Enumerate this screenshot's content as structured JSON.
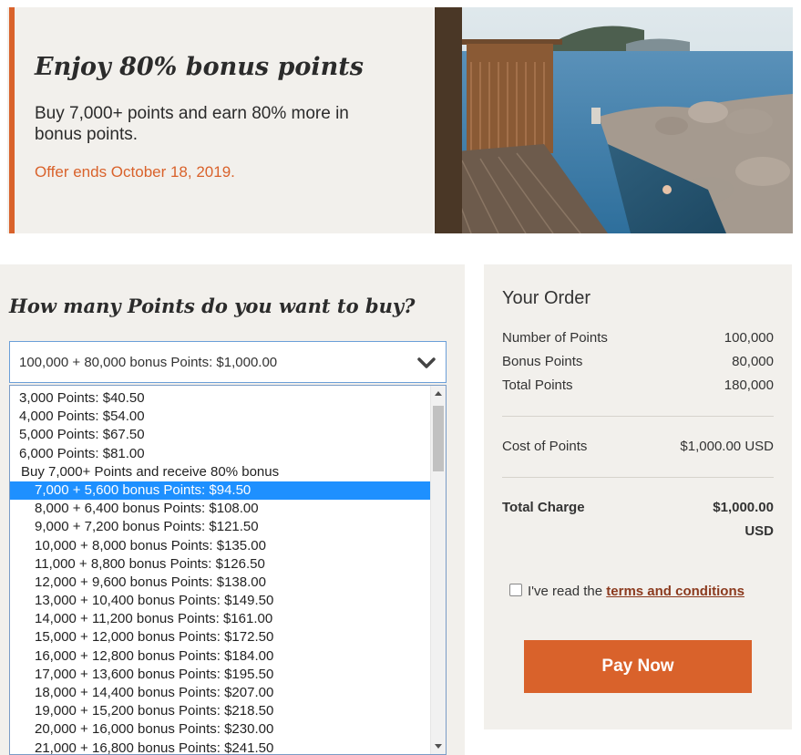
{
  "banner": {
    "title": "Enjoy 80% bonus points",
    "subtitle": "Buy 7,000+ points and earn 80% more in bonus points.",
    "offer_ends": "Offer ends October 18, 2019.",
    "accent_color": "#d9622b",
    "image": "resort-infinity-pool-ocean-photo"
  },
  "purchase": {
    "question": "How many Points do you want to buy?",
    "selected_value": "100,000 + 80,000 bonus Points: $1,000.00",
    "options": [
      {
        "label": "3,000 Points: $40.50",
        "type": "option"
      },
      {
        "label": "4,000 Points: $54.00",
        "type": "option"
      },
      {
        "label": "5,000 Points: $67.50",
        "type": "option"
      },
      {
        "label": "6,000 Points: $81.00",
        "type": "option"
      },
      {
        "label": "Buy 7,000+ Points and receive 80% bonus",
        "type": "group"
      },
      {
        "label": "7,000 + 5,600 bonus Points: $94.50",
        "type": "option",
        "highlighted": true
      },
      {
        "label": "8,000 + 6,400 bonus Points: $108.00",
        "type": "option"
      },
      {
        "label": "9,000 + 7,200 bonus Points: $121.50",
        "type": "option"
      },
      {
        "label": "10,000 + 8,000 bonus Points: $135.00",
        "type": "option"
      },
      {
        "label": "11,000 + 8,800 bonus Points: $126.50",
        "type": "option"
      },
      {
        "label": "12,000 + 9,600 bonus Points: $138.00",
        "type": "option"
      },
      {
        "label": "13,000 + 10,400 bonus Points: $149.50",
        "type": "option"
      },
      {
        "label": "14,000 + 11,200 bonus Points: $161.00",
        "type": "option"
      },
      {
        "label": "15,000 + 12,000 bonus Points: $172.50",
        "type": "option"
      },
      {
        "label": "16,000 + 12,800 bonus Points: $184.00",
        "type": "option"
      },
      {
        "label": "17,000 + 13,600 bonus Points: $195.50",
        "type": "option"
      },
      {
        "label": "18,000 + 14,400 bonus Points: $207.00",
        "type": "option"
      },
      {
        "label": "19,000 + 15,200 bonus Points: $218.50",
        "type": "option"
      },
      {
        "label": "20,000 + 16,000 bonus Points: $230.00",
        "type": "option"
      },
      {
        "label": "21,000 + 16,800 bonus Points: $241.50",
        "type": "option"
      }
    ],
    "highlight_color": "#1e90ff"
  },
  "order": {
    "title": "Your Order",
    "number_of_points_label": "Number of Points",
    "number_of_points_value": "100,000",
    "bonus_points_label": "Bonus Points",
    "bonus_points_value": "80,000",
    "total_points_label": "Total Points",
    "total_points_value": "180,000",
    "cost_label": "Cost of Points",
    "cost_value": "$1,000.00 USD",
    "total_charge_label": "Total Charge",
    "total_charge_amount": "$1,000.00",
    "total_charge_currency": "USD",
    "terms_prefix": "I've read the",
    "terms_link": "terms and conditions",
    "terms_checked": false,
    "pay_button": "Pay Now"
  }
}
